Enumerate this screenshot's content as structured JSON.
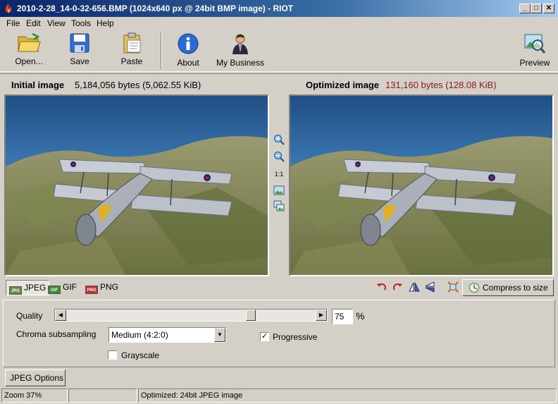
{
  "window": {
    "title": "2010-2-28_14-0-32-656.BMP (1024x640 px @ 24bit BMP image) - RIOT",
    "controls": [
      "_",
      "□",
      "✕"
    ]
  },
  "menu": [
    "File",
    "Edit",
    "View",
    "Tools",
    "Help"
  ],
  "toolbar": {
    "open": "Open...",
    "save": "Save",
    "paste": "Paste",
    "about": "About",
    "business": "My Business",
    "preview": "Preview"
  },
  "info": {
    "initial_label": "Initial image",
    "initial_value": "5,184,056 bytes (5,062.55 KiB)",
    "optimized_label": "Optimized image",
    "optimized_value": "131,160 bytes (128.08 KiB)",
    "optimized_color": "#8b1a1a"
  },
  "zoom_controls": {
    "one_to_one": "1:1"
  },
  "formats": {
    "jpeg": "JPEG",
    "gif": "GIF",
    "png": "PNG",
    "jpeg_badge": "JPG",
    "gif_badge": "GIF",
    "png_badge": "PNG"
  },
  "compress_to_size": "Compress to size",
  "options": {
    "quality_label": "Quality",
    "quality_value": "75",
    "quality_fraction": 0.75,
    "percent": "%",
    "chroma_label": "Chroma subsampling",
    "chroma_value": "Medium (4:2:0)",
    "progressive_label": "Progressive",
    "progressive_checked": true,
    "grayscale_label": "Grayscale",
    "grayscale_checked": false,
    "tab_label": "JPEG Options"
  },
  "status": {
    "zoom": "Zoom 37%",
    "middle": "",
    "message": "Optimized: 24bit JPEG image"
  }
}
